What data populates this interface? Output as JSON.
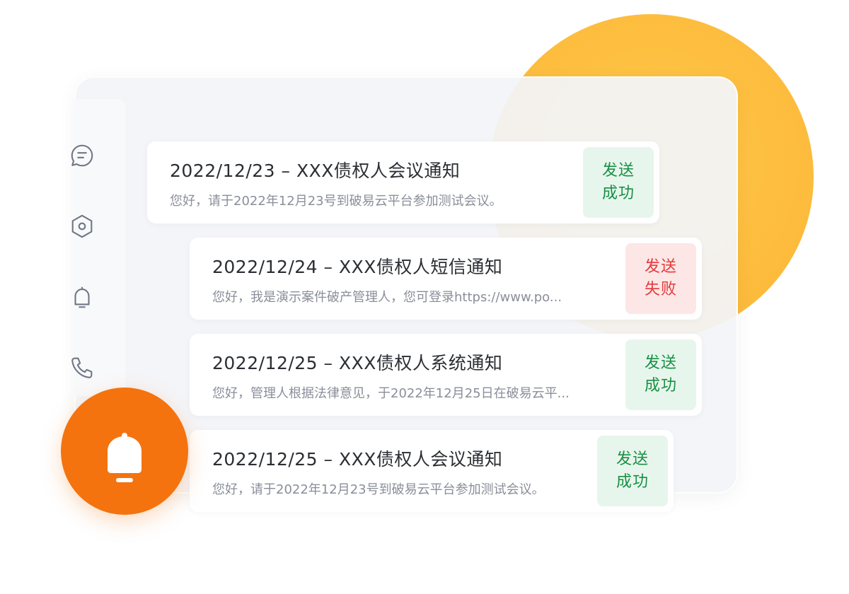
{
  "colors": {
    "accent_orange": "#f4730f",
    "accent_yellow": "#fdbb3c",
    "success_text": "#1a8f45",
    "success_bg": "#e7f6ec",
    "fail_text": "#e23b3b",
    "fail_bg": "#fde6e6"
  },
  "sidebar": {
    "icons": [
      "message-icon",
      "settings-hexagon-icon",
      "bell-icon",
      "phone-icon"
    ]
  },
  "notifications": [
    {
      "title": "2022/12/23 – XXX债权人会议通知",
      "body": "您好，请于2022年12月23号到破易云平台参加测试会议。",
      "status": "发送\n成功",
      "status_line1": "发送",
      "status_line2": "成功",
      "status_type": "success"
    },
    {
      "title": "2022/12/24 – XXX债权人短信通知",
      "body": "您好，我是演示案件破产管理人，您可登录https://www.po...",
      "status_line1": "发送",
      "status_line2": "失败",
      "status_type": "fail"
    },
    {
      "title": "2022/12/25 – XXX债权人系统通知",
      "body": "您好，管理人根据法律意见，于2022年12月25日在破易云平...",
      "status_line1": "发送",
      "status_line2": "成功",
      "status_type": "success"
    },
    {
      "title": "2022/12/25 – XXX债权人会议通知",
      "body": "您好，请于2022年12月23号到破易云平台参加测试会议。",
      "status_line1": "发送",
      "status_line2": "成功",
      "status_type": "success"
    }
  ]
}
